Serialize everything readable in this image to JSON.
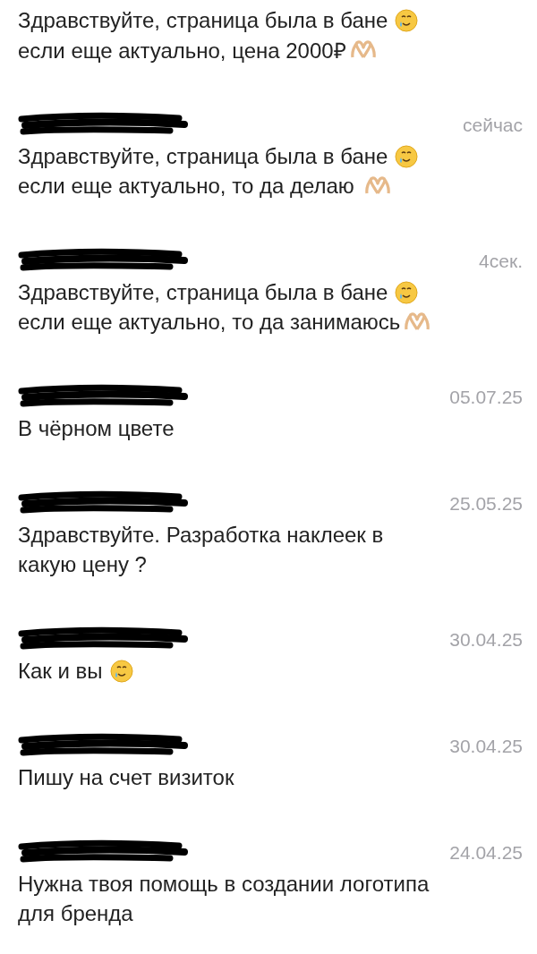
{
  "chats": [
    {
      "lines": [
        {
          "text": "Здравствуйте, страница была в бане",
          "kind": "tear"
        },
        {
          "text": "если еще актуально, цена 2000₽",
          "kind": "heart"
        }
      ]
    },
    {
      "time": "сейчас",
      "lines": [
        {
          "text": "Здравствуйте, страница была в бане",
          "kind": "tear"
        },
        {
          "text": "если еще актуально, то да делаю ",
          "kind": "heart"
        }
      ]
    },
    {
      "time": "4сек.",
      "lines": [
        {
          "text": "Здравствуйте, страница была в бане",
          "kind": "tear"
        },
        {
          "text": "если еще актуально, то да занимаюсь",
          "kind": "heart"
        }
      ]
    },
    {
      "time": "05.07.25",
      "lines": [
        {
          "text": "В чёрном цвете",
          "kind": "plain"
        }
      ]
    },
    {
      "time": "25.05.25",
      "lines": [
        {
          "text": "Здравствуйте. Разработка наклеек в",
          "kind": "plain"
        },
        {
          "text": "какую цену ?",
          "kind": "plain"
        }
      ]
    },
    {
      "time": "30.04.25",
      "lines": [
        {
          "text": "Как и вы",
          "kind": "tear"
        }
      ]
    },
    {
      "time": "30.04.25",
      "lines": [
        {
          "text": "Пишу на счет визиток",
          "kind": "plain"
        }
      ]
    },
    {
      "time": "24.04.25",
      "lines": [
        {
          "text": "Нужна твоя помощь в создании логотипа",
          "kind": "plain"
        },
        {
          "text": "для бренда",
          "kind": "plain"
        }
      ]
    }
  ]
}
